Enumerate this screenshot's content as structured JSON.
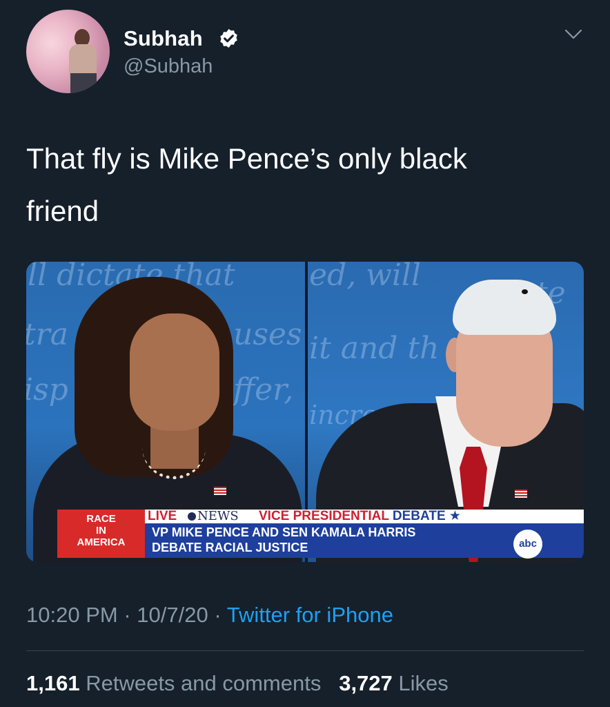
{
  "user": {
    "name": "Subhah",
    "handle": "@Subhah",
    "verified": true
  },
  "tweet": {
    "text_line1": "That fly is Mike Pence’s only black",
    "text_line2": "friend"
  },
  "media": {
    "chyron": {
      "race_line1": "RACE",
      "race_line2": "IN",
      "race_line3": "AMERICA",
      "live": "LIVE",
      "news": "NEWS",
      "headline_part1": "VICE PRESIDENTIAL ",
      "headline_part2": "DEBATE",
      "sub_line1": "VP MIKE PENCE AND SEN KAMALA HARRIS",
      "sub_line2": "DEBATE RACIAL JUSTICE",
      "network_logo": "abc"
    },
    "background_text": {
      "left1": "ll dictate that",
      "left2": "tra",
      "left3": "uses",
      "left4": "isp",
      "left5": "ffer,",
      "right1": "ed, will",
      "right2": "te",
      "right3": "it and th",
      "right4": "incre"
    }
  },
  "footer": {
    "time": "10:20 PM",
    "date": "10/7/20",
    "separator": "·",
    "source": "Twitter for iPhone",
    "retweets_count": "1,161",
    "retweets_label": "Retweets and comments",
    "likes_count": "3,727",
    "likes_label": "Likes"
  },
  "colors": {
    "background": "#15202b",
    "text_secondary": "#8899a6",
    "link": "#1da1f2",
    "divider": "#38444d"
  }
}
